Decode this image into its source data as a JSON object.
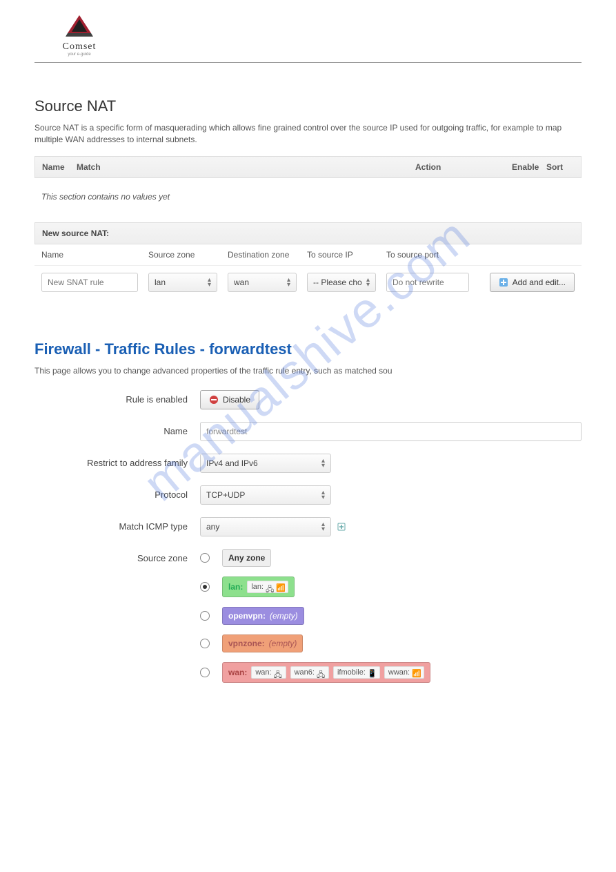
{
  "brand": {
    "name": "Comset",
    "tagline": "your e-guide"
  },
  "watermark": "manualshive.com",
  "snat": {
    "title": "Source NAT",
    "desc": "Source NAT is a specific form of masquerading which allows fine grained control over the source IP used for outgoing traffic, for example to map multiple WAN addresses to internal subnets.",
    "columns": {
      "name": "Name",
      "match": "Match",
      "action": "Action",
      "enable": "Enable",
      "sort": "Sort"
    },
    "empty": "This section contains no values yet",
    "new_label": "New source NAT:",
    "form": {
      "labels": {
        "name": "Name",
        "src": "Source zone",
        "dst": "Destination zone",
        "ip": "To source IP",
        "port": "To source port"
      },
      "name_placeholder": "New SNAT rule",
      "src_value": "lan",
      "dst_value": "wan",
      "ip_value": "-- Please cho",
      "port_placeholder": "Do not rewrite",
      "add_btn": "Add and edit..."
    }
  },
  "rule": {
    "title": "Firewall - Traffic Rules - forwardtest",
    "desc": "This page allows you to change advanced properties of the traffic rule entry, such as matched sou",
    "labels": {
      "enabled": "Rule is enabled",
      "name": "Name",
      "family": "Restrict to address family",
      "protocol": "Protocol",
      "icmp": "Match ICMP type",
      "srczone": "Source zone"
    },
    "disable_btn": "Disable",
    "name_value": "forwardtest",
    "family_value": "IPv4 and IPv6",
    "protocol_value": "TCP+UDP",
    "icmp_value": "any",
    "zones": {
      "any": "Any zone",
      "lan": {
        "label": "lan:",
        "ifaces": [
          "lan:"
        ]
      },
      "openvpn": {
        "label": "openvpn:",
        "empty": "(empty)"
      },
      "vpnzone": {
        "label": "vpnzone:",
        "empty": "(empty)"
      },
      "wan": {
        "label": "wan:",
        "ifaces": [
          "wan:",
          "wan6:",
          "ifmobile:",
          "wwan:"
        ]
      }
    }
  }
}
